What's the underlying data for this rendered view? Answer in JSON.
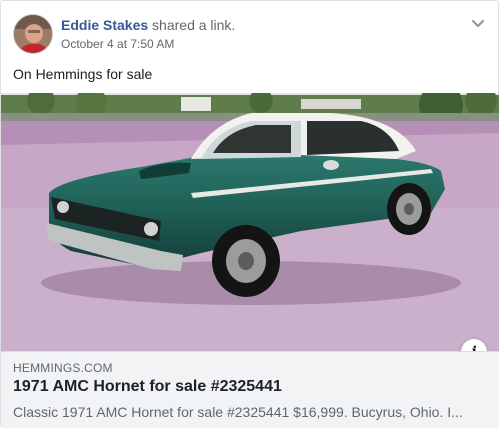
{
  "post": {
    "author": {
      "name": "Eddie Stakes",
      "action": "shared a link.",
      "timestamp": "October 4 at 7:50 AM",
      "avatar_icon": "user-avatar-photo"
    },
    "menu_icon": "chevron-down-icon",
    "text": "On Hemmings for sale"
  },
  "link_preview": {
    "image_description_icon": "car-photo",
    "info_icon": "i",
    "domain": "HEMMINGS.COM",
    "title": "1971 AMC Hornet for sale #2325441",
    "description": "Classic 1971 AMC Hornet for sale #2325441 $16,999. Bucyrus, Ohio. I..."
  },
  "colors": {
    "link_name": "#385898",
    "meta_background": "#f2f3f5",
    "car_body": "#1f5e55",
    "car_roof": "#f4f4f0",
    "pavement": "#c6a8c6"
  }
}
